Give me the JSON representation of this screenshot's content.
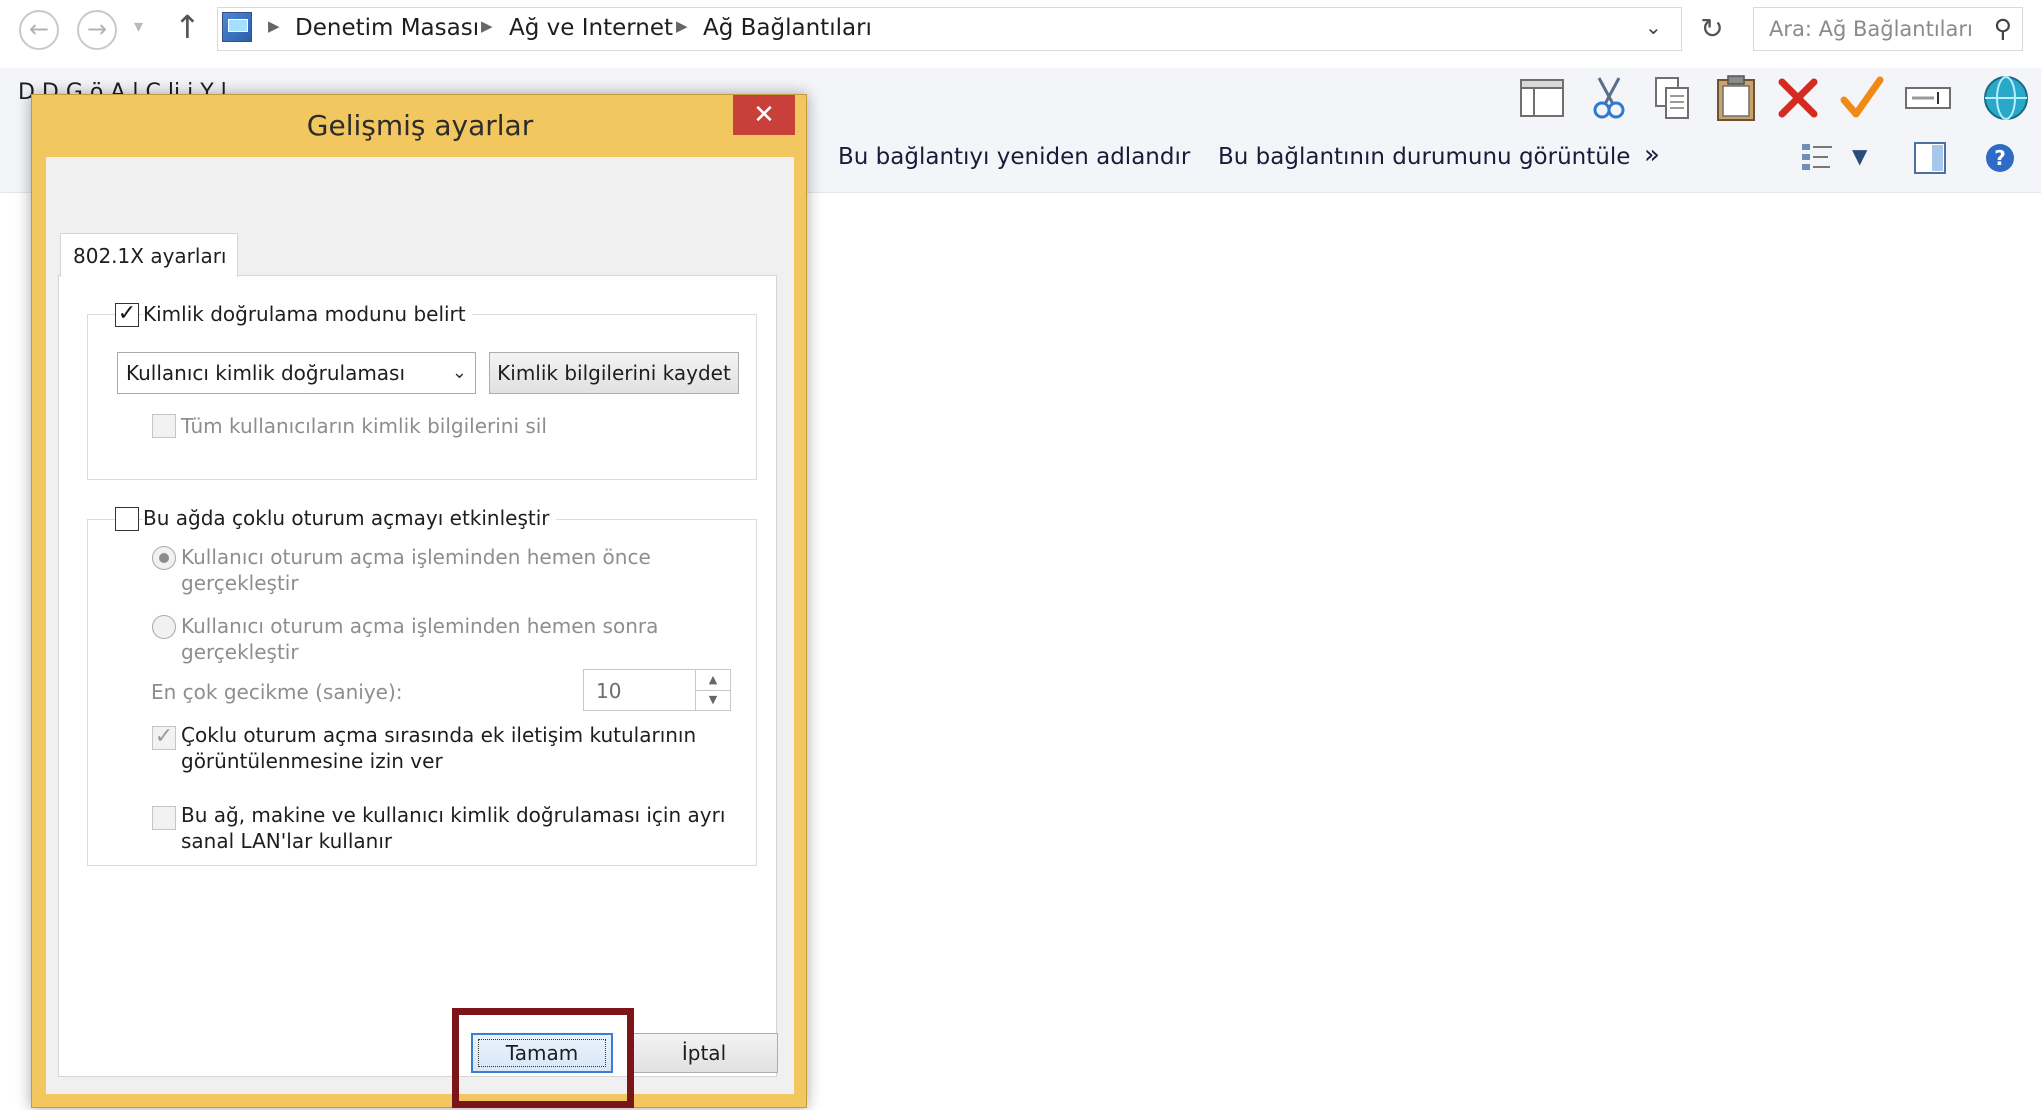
{
  "address": {
    "breadcrumbs": [
      "Denetim Masası",
      "Ağ ve Internet",
      "Ağ Bağlantıları"
    ],
    "search_placeholder": "Ara: Ağ Bağlantıları"
  },
  "nav_icons": {
    "back": "arrow-left-icon",
    "forward": "arrow-right-icon",
    "recent": "chevron-down-icon",
    "up": "arrow-up-icon",
    "refresh": "refresh-icon",
    "search": "magnifier-icon"
  },
  "menu_peek": "D     D      G  ö     A      l  C  li     i    Y    l",
  "toolbar_icons": [
    "layout-icon",
    "cut-icon",
    "copy-icon",
    "paste-icon",
    "delete-icon",
    "properties-icon",
    "rename-icon",
    "globe-icon"
  ],
  "commands": {
    "rename": "Bu bağlantıyı yeniden adlandır",
    "status": "Bu bağlantının durumunu görüntüle",
    "more": "»"
  },
  "dialog": {
    "title": "Gelişmiş ayarlar",
    "close": "✕",
    "tab": "802.1X ayarları",
    "specify_auth_mode": {
      "label": "Kimlik doğrulama modunu belirt",
      "checked": true
    },
    "auth_mode_selected": "Kullanıcı kimlik doğrulaması",
    "save_credentials": "Kimlik bilgilerini kaydet",
    "delete_all_credentials": {
      "label": "Tüm kullanıcıların kimlik bilgilerini sil",
      "checked": false,
      "enabled": false
    },
    "sso": {
      "label": "Bu ağda çoklu oturum açmayı etkinleştir",
      "checked": false
    },
    "sso_before": {
      "line1": "Kullanıcı oturum açma işleminden hemen önce",
      "line2": "gerçekleştir",
      "selected": true
    },
    "sso_after": {
      "line1": "Kullanıcı oturum açma işleminden hemen sonra",
      "line2": "gerçekleştir",
      "selected": false
    },
    "max_delay_label": "En çok gecikme (saniye):",
    "max_delay_value": "10",
    "allow_dialogs": {
      "line1": "Çoklu oturum açma sırasında ek iletişim kutularının",
      "line2": "görüntülenmesine izin ver",
      "checked": true
    },
    "separate_vlans": {
      "line1": "Bu ağ, makine ve kullanıcı kimlik doğrulaması için ayrı",
      "line2": "sanal LAN'lar kullanır",
      "checked": false
    },
    "ok": "Tamam",
    "cancel": "İptal"
  },
  "colors": {
    "dialog_frame": "#f2c75f",
    "close_button": "#c9403a",
    "highlight_box": "#7c1519",
    "ok_border": "#3c7fd1"
  }
}
